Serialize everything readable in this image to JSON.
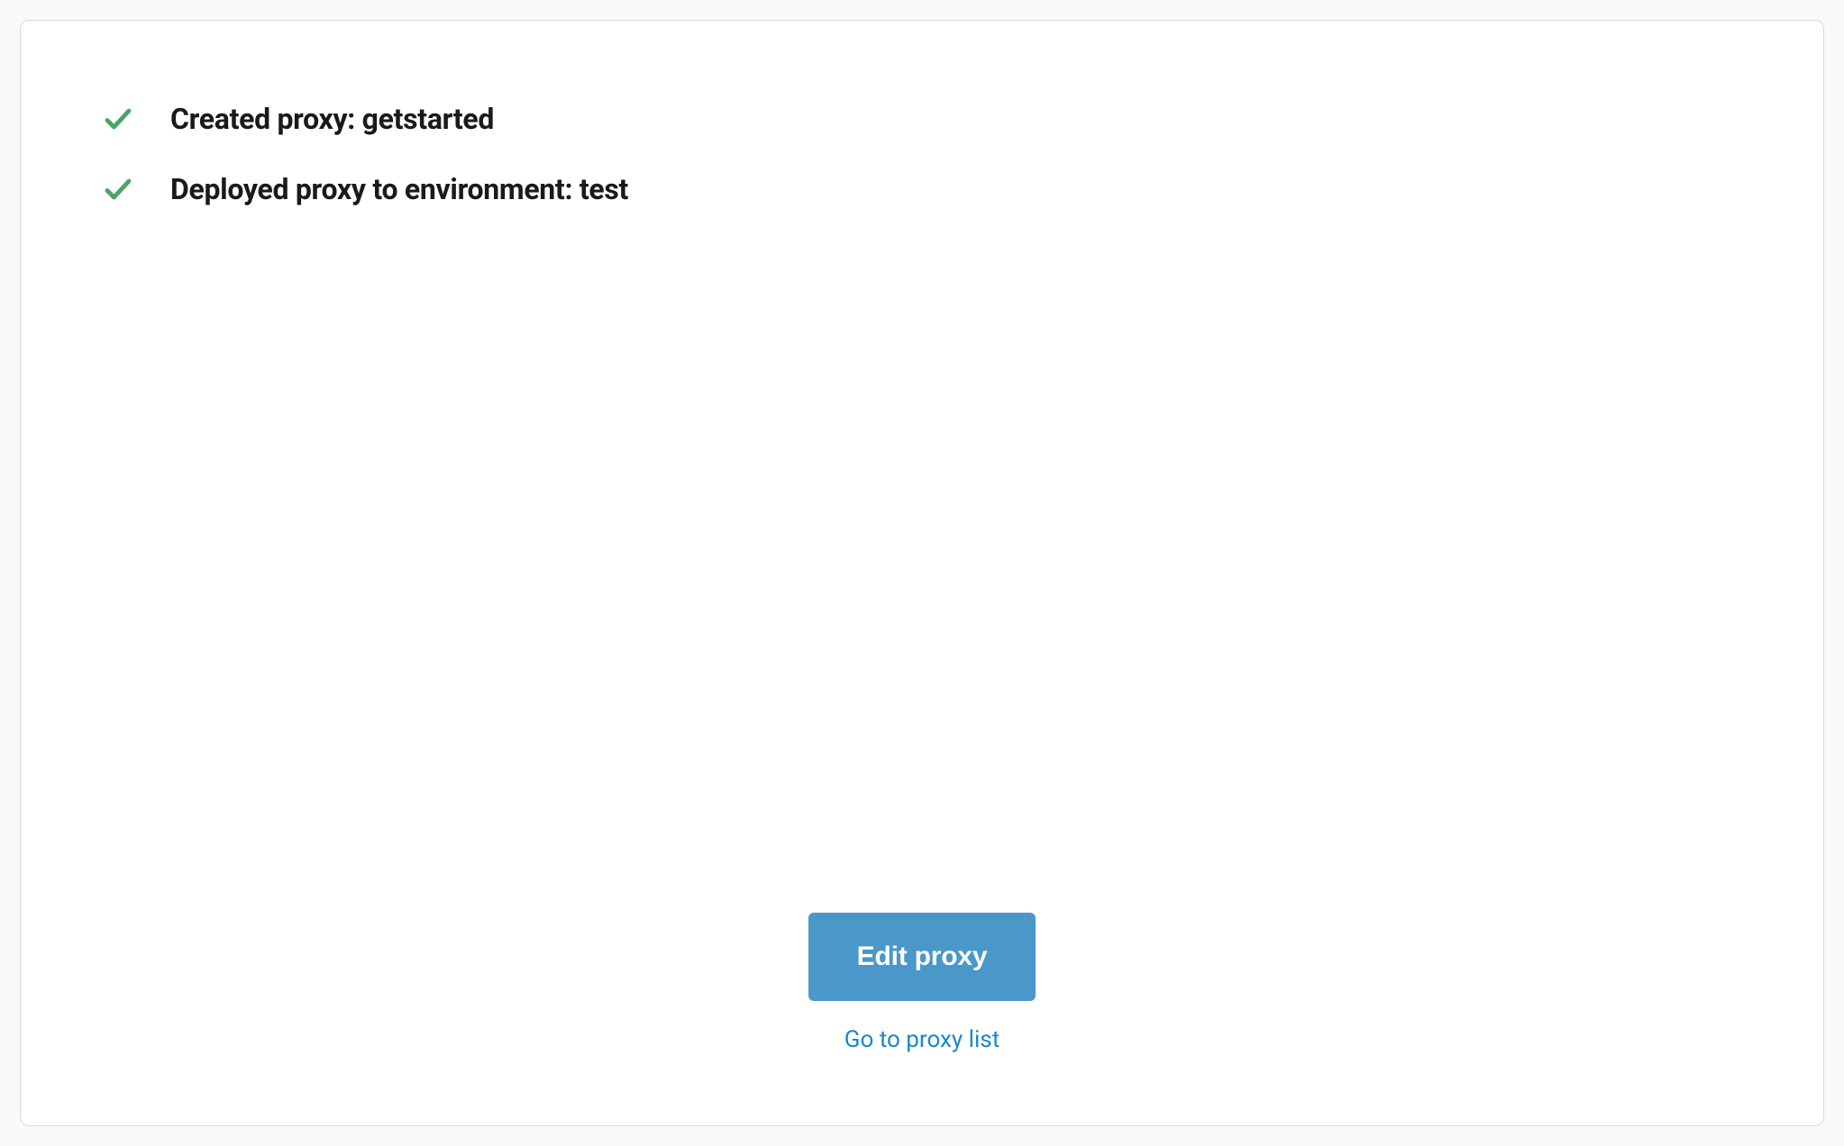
{
  "status": {
    "items": [
      {
        "message": "Created proxy: getstarted"
      },
      {
        "message": "Deployed proxy to environment: test"
      }
    ]
  },
  "actions": {
    "primary_label": "Edit proxy",
    "secondary_label": "Go to proxy list"
  }
}
